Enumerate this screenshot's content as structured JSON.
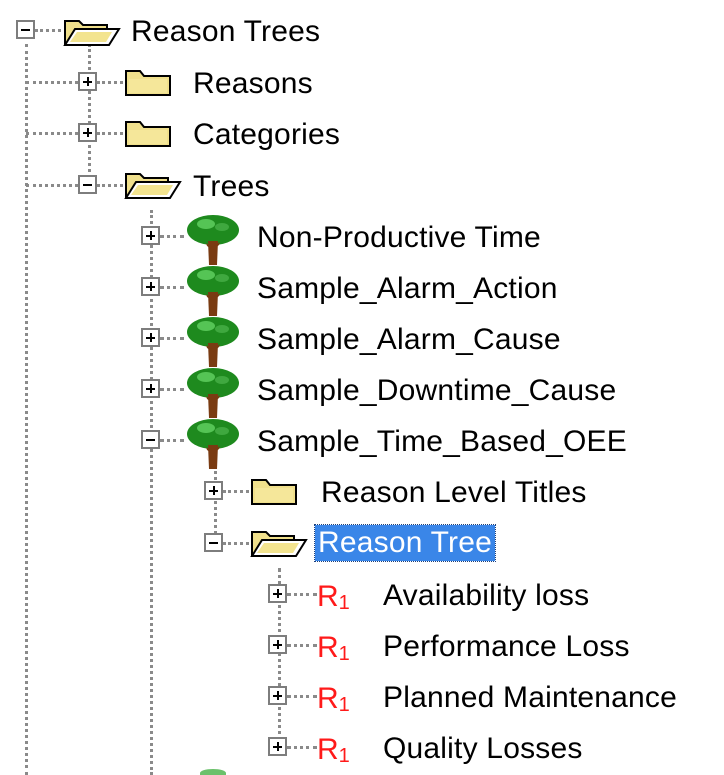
{
  "colors": {
    "selection_bg": "#3a86e8",
    "reason_tag": "#ff1a1a",
    "folder": "#f0e08c",
    "tree_foliage": "#1e8a1e",
    "tree_trunk": "#7a3b12"
  },
  "tree": {
    "root": {
      "label": "Reason Trees",
      "icon": "folder-open-icon",
      "expanded": true
    },
    "reasons": {
      "label": "Reasons",
      "icon": "folder-icon",
      "expanded": false
    },
    "categories": {
      "label": "Categories",
      "icon": "folder-icon",
      "expanded": false
    },
    "trees": {
      "label": "Trees",
      "icon": "folder-open-icon",
      "expanded": true,
      "items": [
        {
          "label": "Non-Productive Time",
          "icon": "tree-icon",
          "expanded": false
        },
        {
          "label": "Sample_Alarm_Action",
          "icon": "tree-icon",
          "expanded": false
        },
        {
          "label": "Sample_Alarm_Cause",
          "icon": "tree-icon",
          "expanded": false
        },
        {
          "label": "Sample_Downtime_Cause",
          "icon": "tree-icon",
          "expanded": false
        },
        {
          "label": "Sample_Time_Based_OEE",
          "icon": "tree-icon",
          "expanded": true
        }
      ]
    },
    "oee": {
      "level_titles": {
        "label": "Reason Level Titles",
        "icon": "folder-icon",
        "expanded": false
      },
      "reason_tree": {
        "label": "Reason Tree",
        "icon": "folder-open-icon",
        "expanded": true,
        "selected": true
      },
      "reason_tag": {
        "main": "R",
        "sub": "1"
      },
      "reasons": [
        {
          "label": "Availability loss",
          "icon": "reason-r1-icon",
          "expanded": false
        },
        {
          "label": "Performance Loss",
          "icon": "reason-r1-icon",
          "expanded": false
        },
        {
          "label": "Planned Maintenance",
          "icon": "reason-r1-icon",
          "expanded": false
        },
        {
          "label": "Quality Losses",
          "icon": "reason-r1-icon",
          "expanded": false
        }
      ]
    }
  }
}
